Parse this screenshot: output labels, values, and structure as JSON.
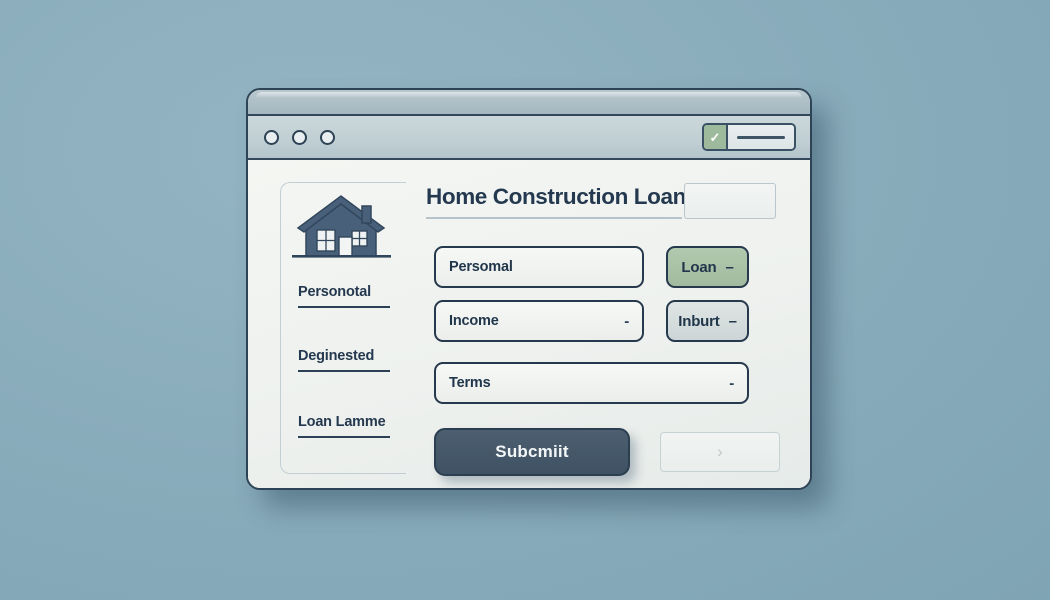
{
  "canvas": {
    "background_color": "#8cafbe"
  },
  "window": {
    "chrome": {
      "dots": [
        "window-dot-1",
        "window-dot-2",
        "window-dot-3"
      ],
      "checkbox": {
        "icon": "checkmark-icon",
        "glyph": "✓",
        "checked": true,
        "color": "#9dbb9c"
      },
      "field_widget": {
        "icon": "horizontal-line-icon"
      }
    },
    "colors": {
      "border": "#2e4356",
      "titlebar": "#c0cfd4",
      "body": "#eef1ef",
      "accent_green": "#a8c4a8",
      "accent_dark": "#465a6b",
      "text": "#24394f"
    }
  },
  "header": {
    "title": "Home Construction Loan"
  },
  "sidebar": {
    "icon": "house-icon",
    "items": [
      {
        "label": "Personotal"
      },
      {
        "label": "Deginested"
      },
      {
        "label": "Loan Lamme"
      }
    ]
  },
  "form": {
    "fields": [
      {
        "name": "personal",
        "value": "Persomal",
        "caret": ""
      },
      {
        "name": "income",
        "value": "Income",
        "caret": "-"
      },
      {
        "name": "terms",
        "value": "Terms",
        "caret": "-"
      }
    ],
    "side_buttons": [
      {
        "name": "loan",
        "label": "Loan",
        "caret": "–",
        "color": "#a8c4a8"
      },
      {
        "name": "inburt",
        "label": "Inburt",
        "caret": "–",
        "color": "#d4dcdc"
      }
    ],
    "submit": {
      "label": "Subcmiit"
    },
    "next": {
      "icon": "chevron-right-icon",
      "glyph": "›"
    }
  }
}
